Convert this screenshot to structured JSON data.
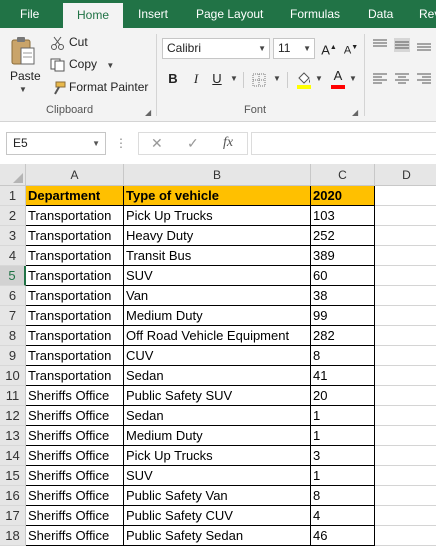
{
  "ribbon_tabs": [
    "File",
    "Home",
    "Insert",
    "Page Layout",
    "Formulas",
    "Data",
    "Rev"
  ],
  "active_tab": "Home",
  "clipboard": {
    "paste_label": "Paste",
    "cut_label": "Cut",
    "copy_label": "Copy",
    "format_painter_label": "Format Painter",
    "group_label": "Clipboard"
  },
  "font": {
    "name": "Calibri",
    "size": "11",
    "bold": "B",
    "italic": "I",
    "underline": "U",
    "grow": "A",
    "shrink": "A",
    "font_color_letter": "A",
    "group_label": "Font"
  },
  "accent_colors": {
    "excel_green": "#217346",
    "header_fill": "#ffc000",
    "highlight_yellow": "#ffff00",
    "font_red": "#ff0000"
  },
  "formula_bar": {
    "name_box": "E5",
    "cancel_icon": "✕",
    "enter_icon": "✓",
    "fx_label": "fx",
    "formula": ""
  },
  "columns": [
    "A",
    "B",
    "C",
    "D"
  ],
  "rows": [
    {
      "n": "1",
      "a": "Department",
      "b": "Type of vehicle",
      "c": "2020"
    },
    {
      "n": "2",
      "a": "Transportation",
      "b": "Pick Up Trucks",
      "c": "103"
    },
    {
      "n": "3",
      "a": "Transportation",
      "b": "Heavy Duty",
      "c": "252"
    },
    {
      "n": "4",
      "a": "Transportation",
      "b": "Transit Bus",
      "c": "389"
    },
    {
      "n": "5",
      "a": "Transportation",
      "b": "SUV",
      "c": "60"
    },
    {
      "n": "6",
      "a": "Transportation",
      "b": "Van",
      "c": "38"
    },
    {
      "n": "7",
      "a": "Transportation",
      "b": "Medium Duty",
      "c": "99"
    },
    {
      "n": "8",
      "a": "Transportation",
      "b": "Off Road Vehicle Equipment",
      "c": "282"
    },
    {
      "n": "9",
      "a": "Transportation",
      "b": "CUV",
      "c": "8"
    },
    {
      "n": "10",
      "a": "Transportation",
      "b": "Sedan",
      "c": "41"
    },
    {
      "n": "11",
      "a": "Sheriffs Office",
      "b": "Public Safety SUV",
      "c": "20"
    },
    {
      "n": "12",
      "a": "Sheriffs Office",
      "b": "Sedan",
      "c": "1"
    },
    {
      "n": "13",
      "a": "Sheriffs Office",
      "b": "Medium Duty",
      "c": "1"
    },
    {
      "n": "14",
      "a": "Sheriffs Office",
      "b": "Pick Up Trucks",
      "c": "3"
    },
    {
      "n": "15",
      "a": "Sheriffs Office",
      "b": "SUV",
      "c": "1"
    },
    {
      "n": "16",
      "a": "Sheriffs Office",
      "b": "Public Safety Van",
      "c": "8"
    },
    {
      "n": "17",
      "a": "Sheriffs Office",
      "b": "Public Safety CUV",
      "c": "4"
    },
    {
      "n": "18",
      "a": "Sheriffs Office",
      "b": "Public Safety Sedan",
      "c": "46"
    }
  ]
}
